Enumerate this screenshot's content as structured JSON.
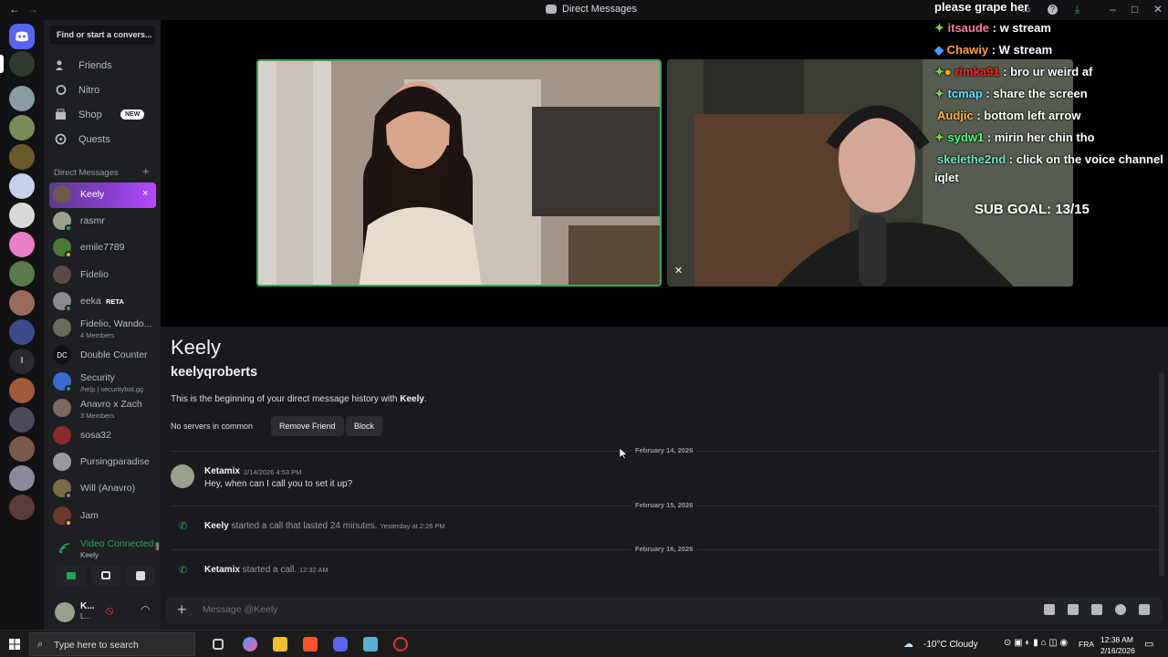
{
  "window": {
    "title": "Direct Messages",
    "back": "←",
    "forward": "→"
  },
  "sidebar": {
    "search_label": "Find or start a convers...",
    "nav": [
      {
        "label": "Friends",
        "icon": "friends-icon"
      },
      {
        "label": "Nitro",
        "icon": "nitro-icon"
      },
      {
        "label": "Shop",
        "icon": "shop-icon",
        "badge": "NEW"
      },
      {
        "label": "Quests",
        "icon": "quests-icon"
      }
    ],
    "dm_header": "Direct Messages",
    "dm_add": "+",
    "dms": [
      {
        "name": "Keely",
        "active": true,
        "close": "×"
      },
      {
        "name": "rasmr"
      },
      {
        "name": "emile7789"
      },
      {
        "name": "Fidelio"
      },
      {
        "name": "eeka",
        "tag": "RETA"
      },
      {
        "name": "Fidelio, Wando...",
        "sub": "4 Members"
      },
      {
        "name": "Double Counter"
      },
      {
        "name": "Security",
        "sub": "/help | securitybot.gg"
      },
      {
        "name": "Anavro x Zach",
        "sub": "3 Members"
      },
      {
        "name": "sosa32"
      },
      {
        "name": "Pursingparadise"
      },
      {
        "name": "Will (Anavro)"
      },
      {
        "name": "Jam"
      }
    ]
  },
  "voice": {
    "status": "Video Connected",
    "channel": "Keely"
  },
  "user": {
    "name": "K...",
    "status": "L..."
  },
  "stream_chat": [
    {
      "user": "",
      "text": "please grape her",
      "color": "#ffffff"
    },
    {
      "user": "itsaude",
      "text": " : w stream",
      "color": "#ff7aa0"
    },
    {
      "user": "Chawiy",
      "text": " : W stream",
      "color": "#ff9f3b"
    },
    {
      "user": "rimka91",
      "text": " : bro ur weird af",
      "color": "#ff2020"
    },
    {
      "user": "tcmap",
      "text": " : share the screen",
      "color": "#5fe3ff"
    },
    {
      "user": "Audjic",
      "text": " : bottom left arrow",
      "color": "#ffb545"
    },
    {
      "user": "sydw1",
      "text": " : mirin her chin tho",
      "color": "#4dff7a"
    },
    {
      "user": "skelethe2nd",
      "text": " : click on the voice channel",
      "color": "#6fe6c8"
    },
    {
      "user": "",
      "text": "iqlet",
      "color": "#ffffff"
    }
  ],
  "sub_goal": "SUB GOAL: 13/15",
  "profile": {
    "display_name": "Keely",
    "username": "keelyqroberts",
    "beginning_prefix": "This is the beginning of your direct message history with ",
    "beginning_name": "Keely",
    "beginning_suffix": ".",
    "no_servers": "No servers in common",
    "remove_friend": "Remove Friend",
    "block": "Block"
  },
  "messages": {
    "date1": "February 14, 2026",
    "m1_author": "Ketamix",
    "m1_time": "2/14/2026 4:53 PM",
    "m1_text": "Hey, when can I call you to set it up?",
    "date2": "February 15, 2026",
    "call1_name": "Keely",
    "call1_text": " started a call that lasted 24 minutes. ",
    "call1_time": "Yesterday at 2:26 PM",
    "date3": "February 16, 2026",
    "call2_name": "Ketamix",
    "call2_text": " started a call. ",
    "call2_time": "12:32 AM"
  },
  "composer": {
    "placeholder": "Message @Keely",
    "plus": "+"
  },
  "taskbar": {
    "search_placeholder": "Type here to search",
    "weather": "-10°C  Cloudy",
    "language": "FRA",
    "time": "12:38 AM",
    "date": "2/16/2026"
  }
}
